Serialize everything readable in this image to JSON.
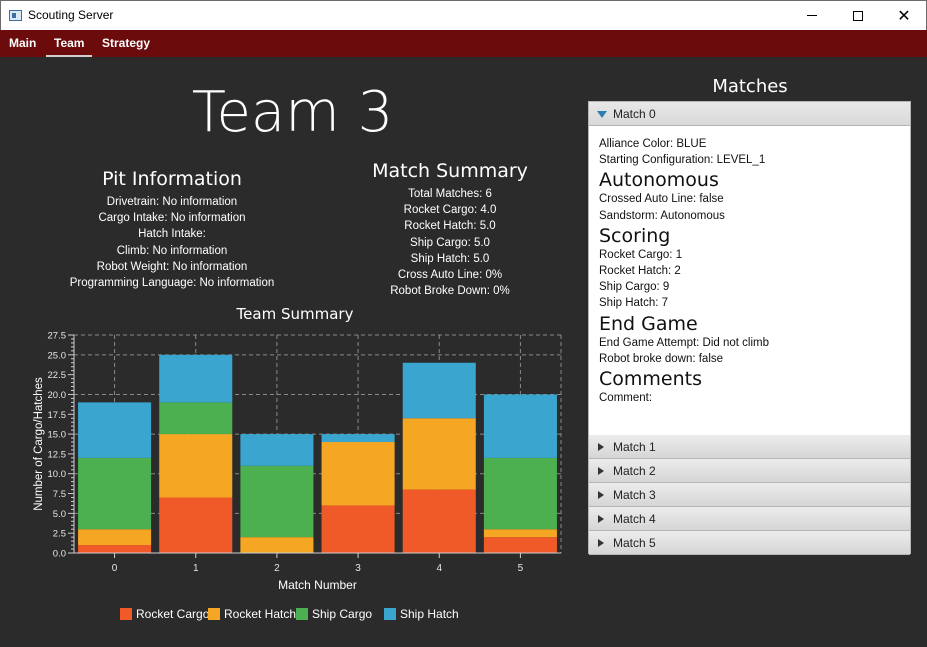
{
  "window": {
    "title": "Scouting Server"
  },
  "menu": {
    "items": [
      "Main",
      "Team",
      "Strategy"
    ],
    "active": "Team"
  },
  "page_title": "Team 3",
  "pit": {
    "title": "Pit Information",
    "lines": [
      "Drivetrain: No information",
      "Cargo Intake: No information",
      "Hatch Intake:",
      "Climb: No information",
      "Robot Weight: No information",
      "Programming Language: No information"
    ]
  },
  "summary": {
    "title": "Match Summary",
    "lines": [
      "Total Matches: 6",
      "Rocket Cargo: 4.0",
      "Rocket Hatch: 5.0",
      "Ship Cargo: 5.0",
      "Ship Hatch: 5.0",
      "Cross Auto Line: 0%",
      "Robot Broke Down: 0%"
    ]
  },
  "chart_title": "Team Summary",
  "chart_data": {
    "type": "bar",
    "stacked": true,
    "title": "Team Summary",
    "xlabel": "Match Number",
    "ylabel": "Number of Cargo/Hatches",
    "categories": [
      "0",
      "1",
      "2",
      "3",
      "4",
      "5"
    ],
    "ylim": [
      0,
      27.5
    ],
    "yticks": [
      "0.0",
      "2.5",
      "5.0",
      "7.5",
      "10.0",
      "12.5",
      "15.0",
      "17.5",
      "20.0",
      "22.5",
      "25.0",
      "27.5"
    ],
    "series": [
      {
        "name": "Rocket Cargo",
        "color": "#f05a28",
        "values": [
          1,
          7,
          0,
          6,
          8,
          2
        ]
      },
      {
        "name": "Rocket Hatch",
        "color": "#f5a623",
        "values": [
          2,
          8,
          2,
          8,
          9,
          1
        ]
      },
      {
        "name": "Ship Cargo",
        "color": "#4caf50",
        "values": [
          9,
          4,
          9,
          0,
          0,
          9
        ]
      },
      {
        "name": "Ship Hatch",
        "color": "#3aa6d0",
        "values": [
          7,
          6,
          4,
          1,
          7,
          8
        ]
      }
    ],
    "grid": true,
    "legend_position": "bottom"
  },
  "matches": {
    "title": "Matches",
    "items": [
      {
        "label": "Match 0",
        "open": true
      },
      {
        "label": "Match 1",
        "open": false
      },
      {
        "label": "Match 2",
        "open": false
      },
      {
        "label": "Match 3",
        "open": false
      },
      {
        "label": "Match 4",
        "open": false
      },
      {
        "label": "Match 5",
        "open": false
      }
    ],
    "detail": {
      "alliance": "Alliance Color: BLUE",
      "starting": "Starting Configuration: LEVEL_1",
      "auto_h": "Autonomous",
      "auto_lines": [
        "Crossed Auto Line: false",
        "Sandstorm: Autonomous"
      ],
      "scoring_h": "Scoring",
      "scoring_lines": [
        "Rocket Cargo: 1",
        "Rocket Hatch: 2",
        "Ship Cargo: 9",
        "Ship Hatch: 7"
      ],
      "end_h": "End Game",
      "end_lines": [
        "End Game Attempt: Did not climb",
        "Robot broke down: false"
      ],
      "comments_h": "Comments",
      "comment": "Comment:"
    }
  }
}
